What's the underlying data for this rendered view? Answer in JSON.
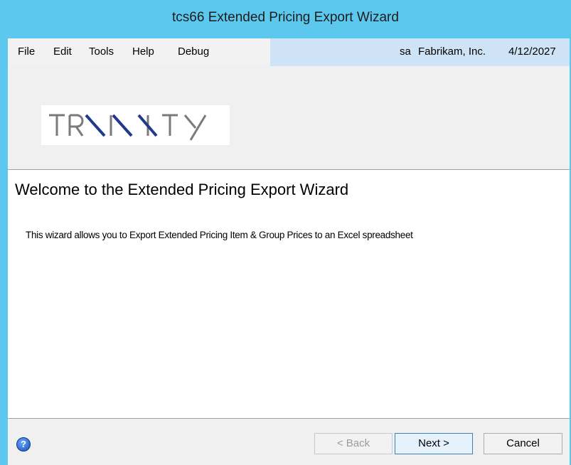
{
  "window": {
    "title": "tcs66 Extended Pricing Export Wizard"
  },
  "menu": {
    "items": [
      "File",
      "Edit",
      "Tools",
      "Help",
      "Debug"
    ]
  },
  "status": {
    "user": "sa",
    "company": "Fabrikam, Inc.",
    "date": "4/12/2027"
  },
  "logo": {
    "text": "TRINITY",
    "icon": "trinity-logo"
  },
  "main": {
    "heading": "Welcome to the Extended Pricing Export Wizard",
    "description": "This wizard allows you to Export Extended Pricing Item & Group Prices to an Excel spreadsheet"
  },
  "footer": {
    "help_icon": "help-icon",
    "back_label": "< Back",
    "next_label": "Next >",
    "cancel_label": "Cancel"
  },
  "colors": {
    "titlebar": "#5cc8ee",
    "status_area": "#cfe3f6",
    "logo_slash": "#1f3a8a",
    "logo_text": "#7a7a7a"
  }
}
